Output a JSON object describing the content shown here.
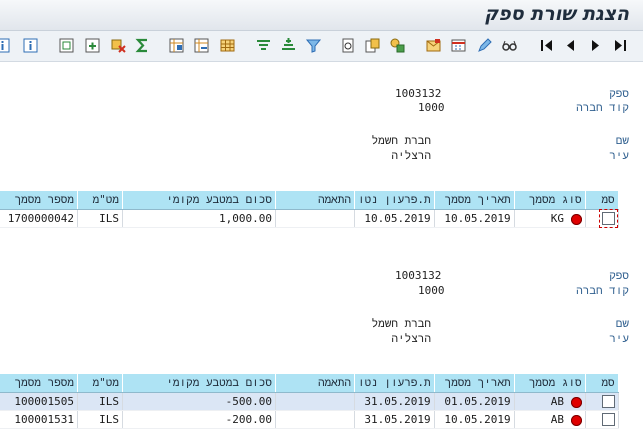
{
  "window": {
    "title": "הצגת שורת ספק"
  },
  "toolbar": {
    "icons": [
      "info-icon",
      "info-icon",
      "select-layout-icon",
      "save-layout-icon",
      "settings-icon",
      "sum-icon",
      "export-icon",
      "import-icon",
      "table-icon",
      "filter-up-icon",
      "filter-down-icon",
      "funnel-icon",
      "detail-icon",
      "copy-icon",
      "graphic-icon",
      "mail-icon",
      "calendar-icon",
      "edit-icon",
      "glasses-icon",
      "first-page-icon",
      "previous-page-icon",
      "next-page-icon",
      "last-page-icon"
    ]
  },
  "labels": {
    "vendor": "ספק",
    "company_code": "קוד חברה",
    "name": "שם",
    "city": "עיר"
  },
  "columns": [
    "מספר מסמך",
    "מט\"מ",
    "סכום במטבע מקומי",
    "התאמה",
    "ת.פרעון נטו",
    "תאריך מסמך",
    "סוג מסמך",
    "סמ"
  ],
  "blocks": [
    {
      "vendor": "1003132",
      "company_code": "1000",
      "name": "חברת חשמל",
      "city": "הרצליה",
      "rows": [
        {
          "doc_no": "1700000042",
          "currency": "ILS",
          "amount": "1,000.00",
          "clearing": "",
          "net_due": "10.05.2019",
          "doc_date": "10.05.2019",
          "doc_type": "KG"
        }
      ]
    },
    {
      "vendor": "1003132",
      "company_code": "1000",
      "name": "חברת חשמל",
      "city": "הרצליה",
      "rows": [
        {
          "doc_no": "100001505",
          "currency": "ILS",
          "amount": "-500.00",
          "clearing": "",
          "net_due": "31.05.2019",
          "doc_date": "01.05.2019",
          "doc_type": "AB"
        },
        {
          "doc_no": "100001531",
          "currency": "ILS",
          "amount": "-200.00",
          "clearing": "",
          "net_due": "31.05.2019",
          "doc_date": "10.05.2019",
          "doc_type": "AB"
        }
      ]
    }
  ],
  "colors": {
    "header_bg": "#aee3f4",
    "label": "#2f5f8f",
    "status_lamp": "#e00000"
  }
}
